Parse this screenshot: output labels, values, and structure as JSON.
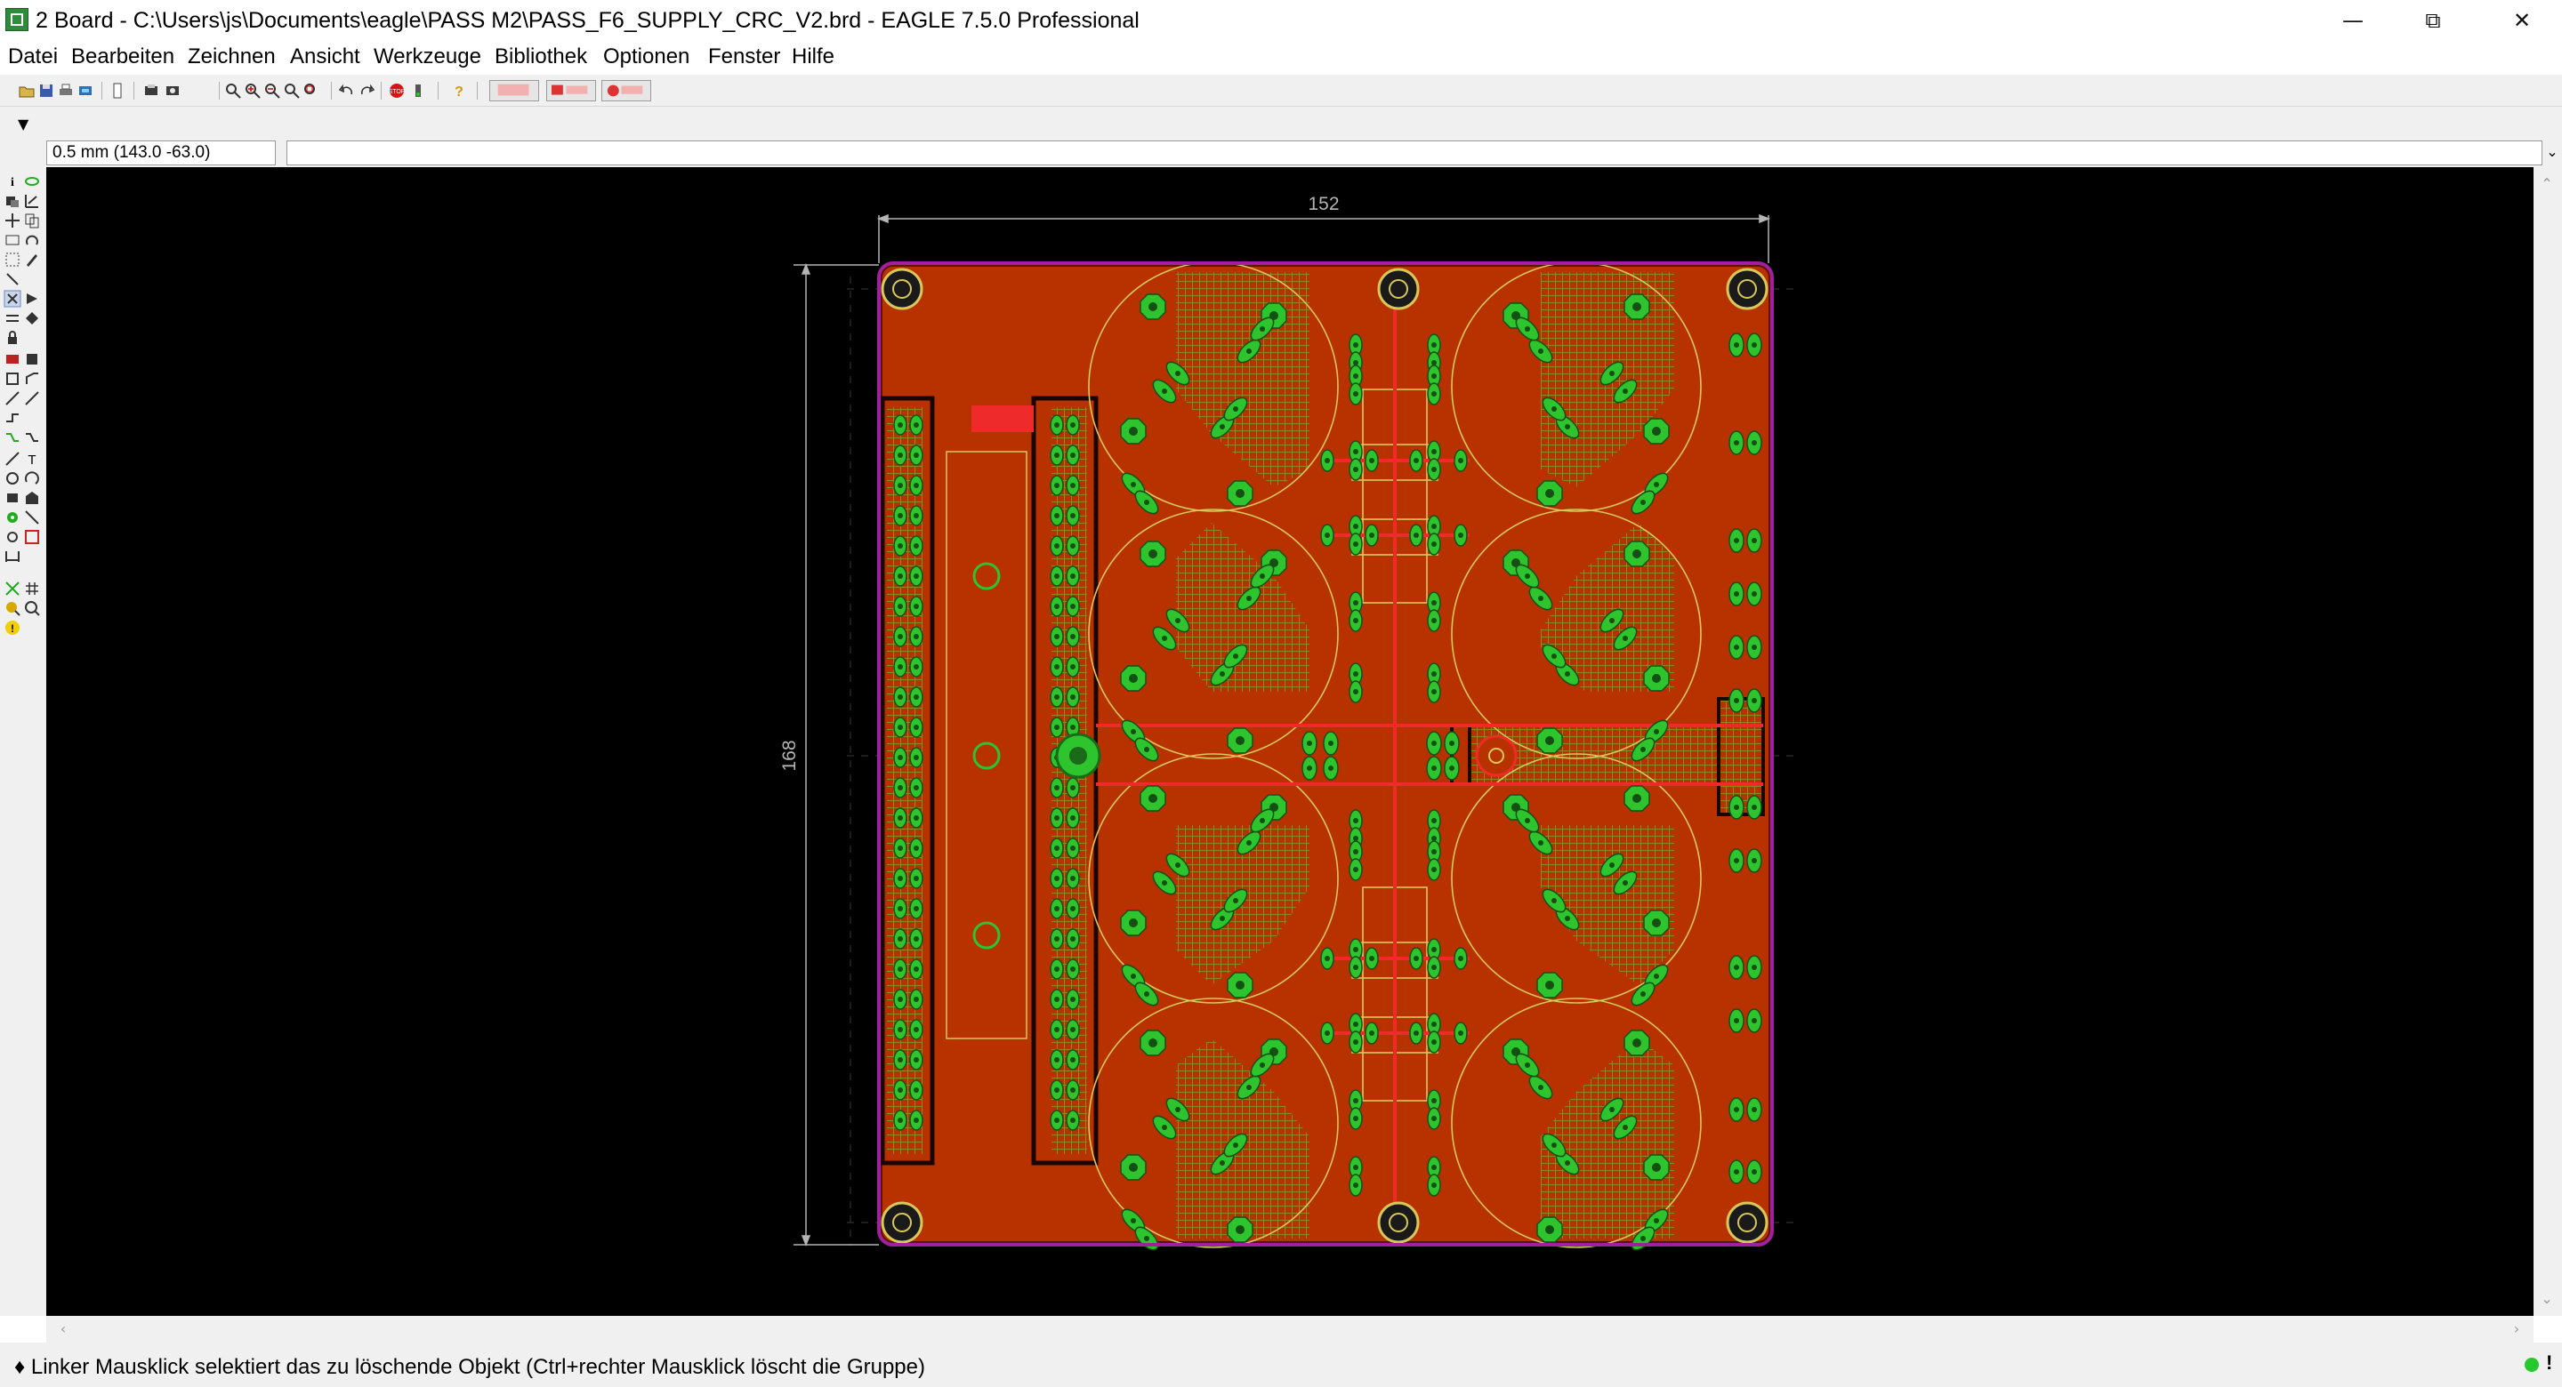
{
  "window": {
    "title": "2 Board - C:\\Users\\js\\Documents\\eagle\\PASS M2\\PASS_F6_SUPPLY_CRC_V2.brd - EAGLE 7.5.0 Professional",
    "minimize_icon": "minimize-icon",
    "maximize_icon": "restore-icon",
    "close_icon": "close-icon"
  },
  "menu": [
    {
      "label": "Datei"
    },
    {
      "label": "Bearbeiten"
    },
    {
      "label": "Zeichnen"
    },
    {
      "label": "Ansicht"
    },
    {
      "label": "Werkzeuge"
    },
    {
      "label": "Bibliothek"
    },
    {
      "label": "Optionen"
    },
    {
      "label": "Fenster"
    },
    {
      "label": "Hilfe"
    }
  ],
  "toolbar": {
    "icons": [
      "open-icon",
      "save-icon",
      "print-icon",
      "cam-icon",
      "script-icon",
      "ulp-icon",
      "zoom-fit-icon",
      "zoom-in-icon",
      "zoom-out-icon",
      "zoom-redraw-icon",
      "zoom-select-icon",
      "undo-icon",
      "redo-icon",
      "stop-icon",
      "go-icon",
      "help-icon"
    ],
    "extra_buttons": [
      "design-link-icon",
      "pcb-quote-icon",
      "idf-export-icon"
    ]
  },
  "command": {
    "coordinate_readout": "0.5 mm (143.0 -63.0)",
    "input_value": ""
  },
  "board": {
    "dimension_width": "152",
    "dimension_height": "168",
    "colors": {
      "background": "#000000",
      "copper_top": "#b83200",
      "copper_border": "#5a1400",
      "hatch": "#8b8a1d",
      "pad": "#2dc42d",
      "dimension": "#b4b4b4",
      "outline": "#a020a0",
      "silkscreen": "#d8c85a"
    }
  },
  "status": {
    "message": "♦ Linker Mausklick selektiert das zu löschende Objekt (Ctrl+rechter Mausklick löscht die Gruppe)",
    "indicator_color": "#27c82e",
    "warning_text": "!"
  }
}
